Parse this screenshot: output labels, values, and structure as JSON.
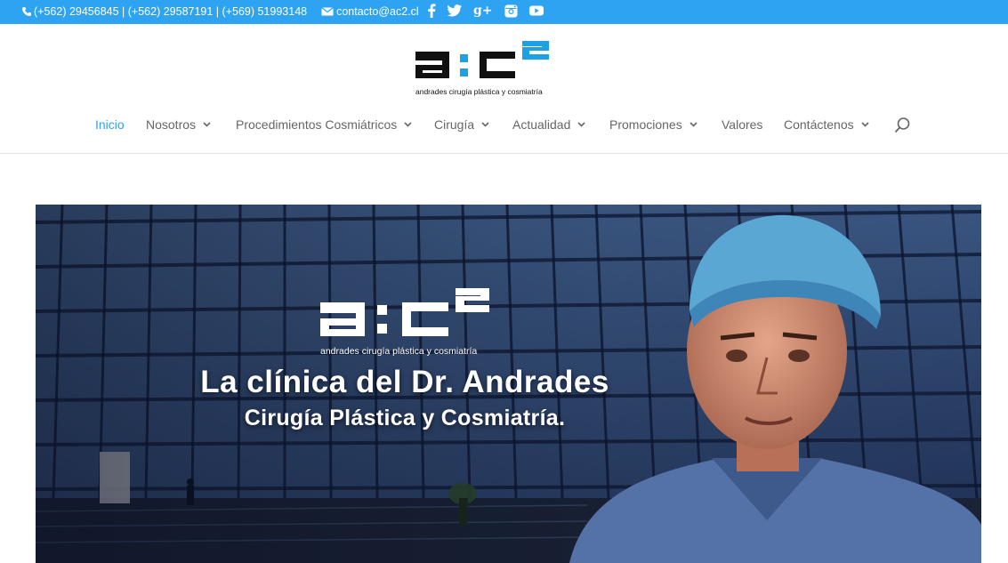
{
  "topbar": {
    "phones": "(+562) 29456845 | (+562) 29587191 | (+569) 51993148",
    "email": "contacto@ac2.cl",
    "social": [
      {
        "name": "facebook",
        "glyph": "f"
      },
      {
        "name": "twitter",
        "glyph": "t"
      },
      {
        "name": "google-plus",
        "glyph": "g+"
      },
      {
        "name": "instagram",
        "glyph": "ig"
      },
      {
        "name": "youtube",
        "glyph": "yt"
      }
    ]
  },
  "logo": {
    "tagline": "andrades cirugía plástica y cosmiatría",
    "mark": "a:c²"
  },
  "nav": {
    "items": [
      {
        "label": "Inicio",
        "active": true,
        "dropdown": false
      },
      {
        "label": "Nosotros",
        "active": false,
        "dropdown": true
      },
      {
        "label": "Procedimientos Cosmiátricos",
        "active": false,
        "dropdown": true
      },
      {
        "label": "Cirugía",
        "active": false,
        "dropdown": true
      },
      {
        "label": "Actualidad",
        "active": false,
        "dropdown": true
      },
      {
        "label": "Promociones",
        "active": false,
        "dropdown": true
      },
      {
        "label": "Valores",
        "active": false,
        "dropdown": false
      },
      {
        "label": "Contáctenos",
        "active": false,
        "dropdown": true
      }
    ]
  },
  "hero": {
    "title": "La clínica del Dr. Andrades",
    "subtitle": "Cirugía Plástica y Cosmiatría.",
    "logo_tagline": "andrades cirugía plástica y cosmiatría"
  },
  "colors": {
    "accent": "#2ea3f2",
    "text": "#666666",
    "logo_blue": "#1da1e4"
  }
}
